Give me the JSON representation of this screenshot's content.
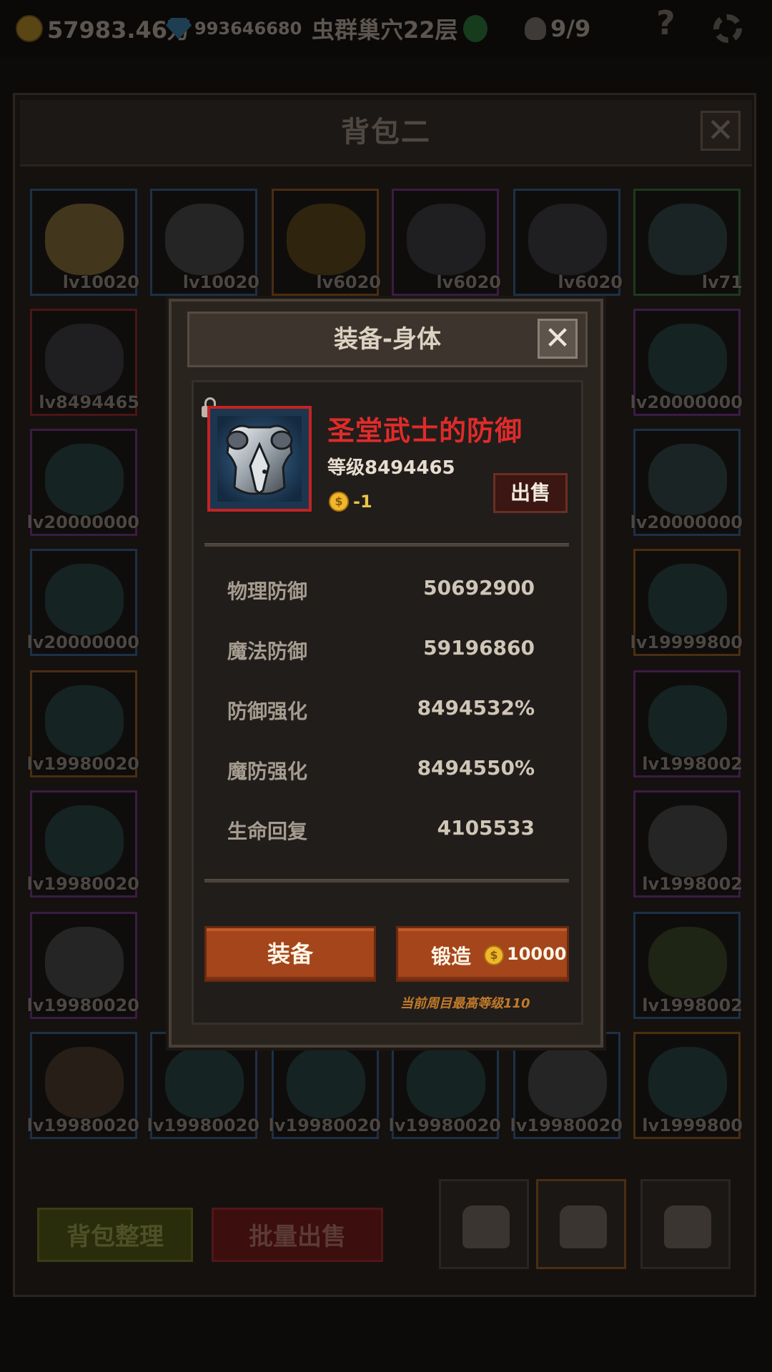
{
  "top_bar": {
    "gold": "57983.46万",
    "gems": "993646680",
    "stage": "虫群巢穴22层",
    "kills": "9/9",
    "help_icon": "question-icon",
    "settings_icon": "gear-icon"
  },
  "bag": {
    "title": "背包二",
    "close": "✕",
    "sort_button": "背包整理",
    "bulk_sell_button": "批量出售",
    "slots": [
      {
        "lv": "lv10020",
        "rarity": "blue",
        "icon": "ring-icon"
      },
      {
        "lv": "lv10020",
        "rarity": "blue",
        "icon": "helmet-icon"
      },
      {
        "lv": "lv6020",
        "rarity": "orange",
        "icon": "necklace-icon"
      },
      {
        "lv": "lv6020",
        "rarity": "purple",
        "icon": "armor-icon"
      },
      {
        "lv": "lv6020",
        "rarity": "blue",
        "icon": "armor-icon"
      },
      {
        "lv": "lv71",
        "rarity": "green",
        "icon": "sword-icon"
      },
      {
        "lv": "lv8494465",
        "rarity": "red",
        "icon": "armor-icon"
      },
      {
        "lv": "lv20000000",
        "rarity": "purple",
        "icon": "orb-icon"
      },
      {
        "lv": "lv20000000",
        "rarity": "purple",
        "icon": "orb-icon"
      },
      {
        "lv": "lv20000000",
        "rarity": "blue",
        "icon": "sword-icon"
      },
      {
        "lv": "lv20000000",
        "rarity": "blue",
        "icon": "orb-icon"
      },
      {
        "lv": "lv19999800",
        "rarity": "orange",
        "icon": "orb-icon"
      },
      {
        "lv": "lv19980020",
        "rarity": "orange",
        "icon": "orb-icon"
      },
      {
        "lv": "lv1998002",
        "rarity": "purple",
        "icon": "orb-icon"
      },
      {
        "lv": "lv19980020",
        "rarity": "purple",
        "icon": "orb-icon"
      },
      {
        "lv": "lv1998002",
        "rarity": "purple",
        "icon": "helmet-icon"
      },
      {
        "lv": "lv19980020",
        "rarity": "purple",
        "icon": "helmet-icon"
      },
      {
        "lv": "lv1998002",
        "rarity": "blue",
        "icon": "gun-icon"
      },
      {
        "lv": "lv19980020",
        "rarity": "blue",
        "icon": "feather-icon"
      },
      {
        "lv": "lv19980020",
        "rarity": "blue",
        "icon": "orb-icon"
      },
      {
        "lv": "lv19980020",
        "rarity": "blue",
        "icon": "orb-icon"
      },
      {
        "lv": "lv19980020",
        "rarity": "blue",
        "icon": "orb-icon"
      },
      {
        "lv": "lv19980020",
        "rarity": "blue",
        "icon": "helmet-icon"
      },
      {
        "lv": "lv1999800",
        "rarity": "orange",
        "icon": "orb-icon"
      }
    ],
    "side_lvs": [
      "00000",
      "00000",
      "00000",
      "0020",
      "0020",
      "0020"
    ]
  },
  "modal": {
    "title": "装备-身体",
    "close": "✕",
    "item_name": "圣堂武士的防御",
    "item_level": "等级8494465",
    "price": "-1",
    "sell_button": "出售",
    "stats": [
      {
        "name": "物理防御",
        "value": "50692900"
      },
      {
        "name": "魔法防御",
        "value": "59196860"
      },
      {
        "name": "防御强化",
        "value": "8494532%"
      },
      {
        "name": "魔防强化",
        "value": "8494550%"
      },
      {
        "name": "生命回复",
        "value": "4105533"
      }
    ],
    "equip_button": "装备",
    "forge_button": "锻造",
    "forge_cost": "10000",
    "max_level_note": "当前周目最高等级110"
  },
  "colors": {
    "rarity_red": "#c42323",
    "item_name": "#df2b2b",
    "button_orange": "#a4451b"
  }
}
